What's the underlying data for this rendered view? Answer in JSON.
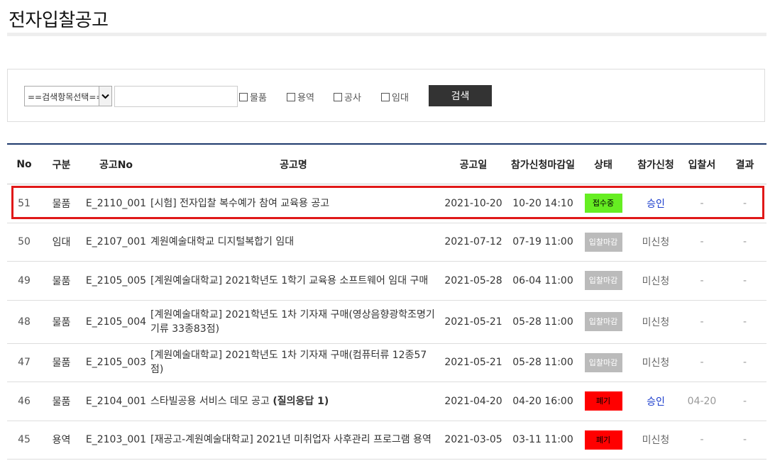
{
  "page": {
    "title": "전자입찰공고"
  },
  "search": {
    "select_value": "==검색항목선택==",
    "input_value": "",
    "checkboxes": [
      {
        "label": "물품",
        "checked": false
      },
      {
        "label": "용역",
        "checked": false
      },
      {
        "label": "공사",
        "checked": false
      },
      {
        "label": "임대",
        "checked": false
      }
    ],
    "button_label": "검색"
  },
  "table": {
    "headers": [
      "No",
      "구분",
      "공고No",
      "공고명",
      "공고일",
      "참가신청마감일",
      "상태",
      "참가신청",
      "입찰서",
      "결과"
    ],
    "rows": [
      {
        "no": "51",
        "type": "물품",
        "pno": "E_2110_001",
        "name": "[시험] 전자입찰 복수예가 참여 교육용 공고",
        "name_bold": "",
        "date": "2021-10-20",
        "deadline": "10-20 14:10",
        "status": "접수중",
        "status_color": "#66ee22",
        "apply": "승인",
        "bid": "-",
        "result": "-"
      },
      {
        "no": "50",
        "type": "임대",
        "pno": "E_2107_001",
        "name": "계원예술대학교 디지털복합기 임대",
        "name_bold": "",
        "date": "2021-07-12",
        "deadline": "07-19 11:00",
        "status": "입찰마감",
        "status_color": "#bbbbbb",
        "apply": "미신청",
        "bid": "-",
        "result": "-"
      },
      {
        "no": "49",
        "type": "물품",
        "pno": "E_2105_005",
        "name": "[계원예술대학교] 2021학년도 1학기 교육용 소프트웨어 임대 구매",
        "name_bold": "",
        "date": "2021-05-28",
        "deadline": "06-04 11:00",
        "status": "입찰마감",
        "status_color": "#bbbbbb",
        "apply": "미신청",
        "bid": "-",
        "result": "-"
      },
      {
        "no": "48",
        "type": "물품",
        "pno": "E_2105_004",
        "name": "[계원예술대학교] 2021학년도 1차 기자재 구매(영상음향광학조명기기류 33종83점)",
        "name_bold": "",
        "date": "2021-05-21",
        "deadline": "05-28 11:00",
        "status": "입찰마감",
        "status_color": "#bbbbbb",
        "apply": "미신청",
        "bid": "-",
        "result": "-"
      },
      {
        "no": "47",
        "type": "물품",
        "pno": "E_2105_003",
        "name": "[계원예술대학교] 2021학년도 1차 기자재 구매(컴퓨터류 12종57점)",
        "name_bold": "",
        "date": "2021-05-21",
        "deadline": "05-28 11:00",
        "status": "입찰마감",
        "status_color": "#bbbbbb",
        "apply": "미신청",
        "bid": "-",
        "result": "-"
      },
      {
        "no": "46",
        "type": "물품",
        "pno": "E_2104_001",
        "name": "스타빌공용 서비스 데모 공고 ",
        "name_bold": "(질의응답 1)",
        "date": "2021-04-20",
        "deadline": "04-20 16:00",
        "status": "폐기",
        "status_color": "#ff0000",
        "apply": "승인",
        "bid": "04-20",
        "result": "-"
      },
      {
        "no": "45",
        "type": "용역",
        "pno": "E_2103_001",
        "name": "[재공고-계원예술대학교] 2021년 미취업자 사후관리 프로그램 용역",
        "name_bold": "",
        "date": "2021-03-05",
        "deadline": "03-11 11:00",
        "status": "폐기",
        "status_color": "#ff0000",
        "apply": "미신청",
        "bid": "-",
        "result": "-"
      }
    ]
  }
}
